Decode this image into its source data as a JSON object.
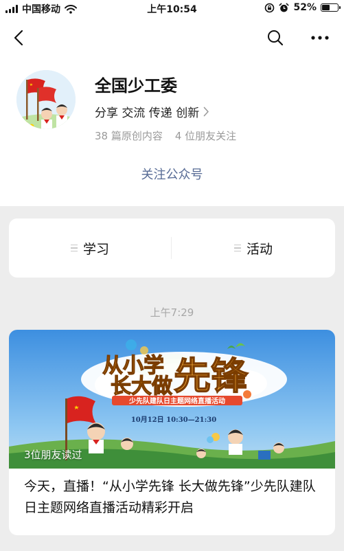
{
  "status_bar": {
    "carrier": "中国移动",
    "time": "上午10:54",
    "battery_percent": "52%",
    "battery_level": 0.52
  },
  "account": {
    "name": "全国少工委",
    "tagline": "分享 交流 传递 创新",
    "stats": {
      "original_count": "38 篇原创内容",
      "friends_following": "4 位朋友关注"
    },
    "follow_label": "关注公众号"
  },
  "menu": {
    "items": [
      {
        "label": "学习"
      },
      {
        "label": "活动"
      }
    ]
  },
  "feed": {
    "timestamp": "上午7:29",
    "article": {
      "cover": {
        "headline_top": "从小学",
        "headline_bottom": "长大做",
        "headline_big": "先锋",
        "subtitle": "少先队建队日主题网络直播活动",
        "date": "10月12日 10:30—21:30"
      },
      "read_badge": "3位朋友读过",
      "title": "今天，直播！“从小学先锋 长大做先锋”少先队建队日主题网络直播活动精彩开启"
    }
  },
  "colors": {
    "link": "#576b95",
    "page_bg": "#ededed",
    "red_flag": "#d8231f",
    "headline_orange": "#f29b13"
  },
  "icons": [
    "signal-icon",
    "wifi-icon",
    "rotation-lock-icon",
    "alarm-icon",
    "battery-icon",
    "back-arrow-icon",
    "search-icon",
    "more-icon",
    "chevron-right-icon",
    "menu-list-icon"
  ]
}
